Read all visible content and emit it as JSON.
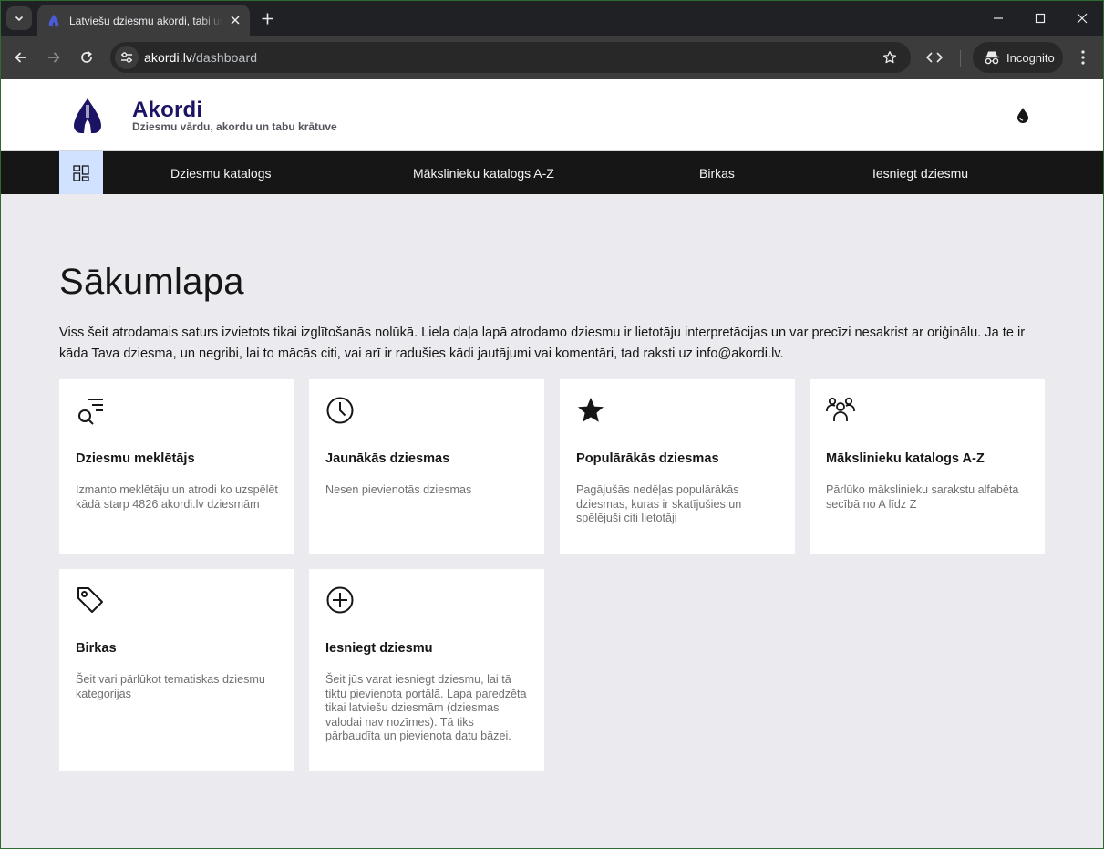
{
  "browser": {
    "tab_title": "Latviešu dziesmu akordi, tabi un dziesmu vārdi",
    "url_host": "akordi.lv",
    "url_path": "/dashboard",
    "incognito_label": "Incognito"
  },
  "site": {
    "brand_title": "Akordi",
    "brand_subtitle": "Dziesmu vārdu, akordu un tabu krātuve",
    "nav": {
      "items": [
        {
          "label": "Dziesmu katalogs"
        },
        {
          "label": "Mākslinieku katalogs A-Z"
        },
        {
          "label": "Birkas"
        },
        {
          "label": "Iesniegt dziesmu"
        }
      ]
    }
  },
  "page": {
    "title": "Sākumlapa",
    "intro": "Viss šeit atrodamais saturs izvietots tikai izglītošanās nolūkā. Liela daļa lapā atrodamo dziesmu ir lietotāju interpretācijas un var precīzi nesakrist ar oriģinālu. Ja te ir kāda Tava dziesma, un negribi, lai to mācās citi, vai arī ir radušies kādi jautājumi vai komentāri, tad raksti uz info@akordi.lv.",
    "cards": [
      {
        "title": "Dziesmu meklētājs",
        "desc": "Izmanto meklētāju un atrodi ko uzspēlēt kādā starp 4826 akordi.lv dziesmām",
        "icon": "search-list-icon"
      },
      {
        "title": "Jaunākās dziesmas",
        "desc": "Nesen pievienotās dziesmas",
        "icon": "clock-icon"
      },
      {
        "title": "Populārākās dziesmas",
        "desc": "Pagājušās nedēļas populārākās dziesmas, kuras ir skatījušies un spēlējuši citi lietotāji",
        "icon": "star-icon"
      },
      {
        "title": "Mākslinieku katalogs A-Z",
        "desc": "Pārlūko mākslinieku sarakstu alfabēta secībā no A līdz Z",
        "icon": "users-icon"
      },
      {
        "title": "Birkas",
        "desc": "Šeit vari pārlūkot tematiskas dziesmu kategorijas",
        "icon": "tag-icon"
      },
      {
        "title": "Iesniegt dziesmu",
        "desc": "Šeit jūs varat iesniegt dziesmu, lai tā tiktu pievienota portālā. Lapa paredzēta tikai latviešu dziesmām (dziesmas valodai nav nozīmes). Tā tiks pārbaudīta un pievienota datu bāzei.",
        "icon": "plus-circle-icon"
      }
    ]
  },
  "colors": {
    "brand": "#1b1464",
    "nav_bg": "#161616",
    "nav_active": "#d0e2ff",
    "page_bg": "#ebebef"
  }
}
